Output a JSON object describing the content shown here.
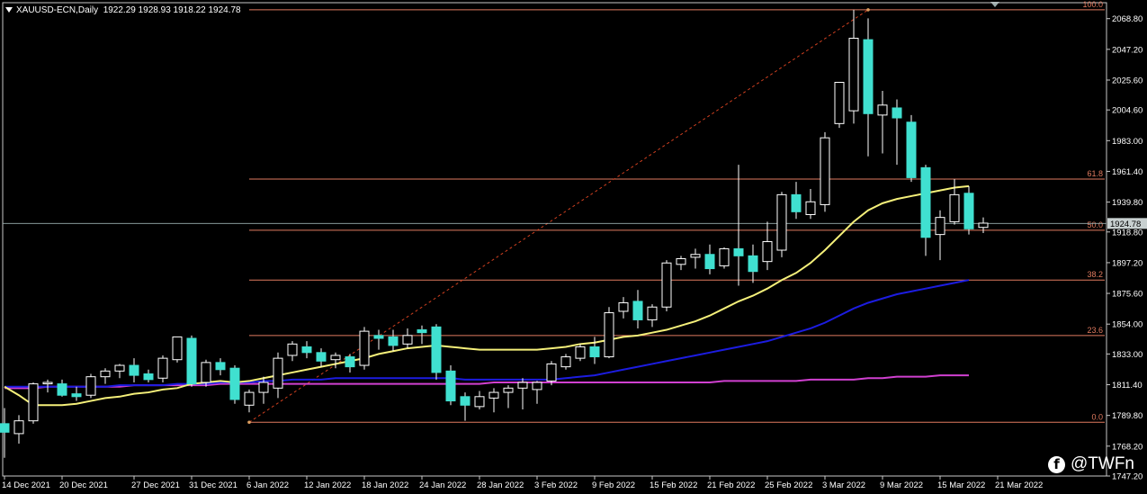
{
  "header": {
    "symbol": "XAUUSD-ECN,Daily",
    "ohlc": "1922.29 1928.93 1918.22 1924.78"
  },
  "watermark": {
    "icon": "facebook-icon",
    "handle": "@TWFn"
  },
  "chart_data": {
    "type": "candlestick",
    "ylim": [
      1747.2,
      2080.0
    ],
    "y_ticks": [
      2068.8,
      2047.2,
      2025.6,
      2004.6,
      1983.0,
      1961.4,
      1939.8,
      1918.8,
      1897.2,
      1875.6,
      1854.0,
      1833.0,
      1811.4,
      1789.8,
      1768.2,
      1747.2
    ],
    "y_tick_labels": [
      "2068.80",
      "2047.20",
      "2025.60",
      "2004.60",
      "1983.00",
      "1961.40",
      "1939.80",
      "1918.80",
      "1897.20",
      "1875.60",
      "1854.00",
      "1833.00",
      "1811.40",
      "1789.80",
      "1768.20",
      "1747.20"
    ],
    "x_tick_labels": [
      "14 Dec 2021",
      "20 Dec 2021",
      "27 Dec 2021",
      "31 Dec 2021",
      "6 Jan 2022",
      "12 Jan 2022",
      "18 Jan 2022",
      "24 Jan 2022",
      "28 Jan 2022",
      "3 Feb 2022",
      "9 Feb 2022",
      "15 Feb 2022",
      "21 Feb 2022",
      "25 Feb 2022",
      "3 Mar 2022",
      "9 Mar 2022",
      "15 Mar 2022",
      "21 Mar 2022"
    ],
    "x_tick_bar_index": [
      0,
      4,
      9,
      13,
      17,
      21,
      25,
      29,
      33,
      37,
      41,
      45,
      49,
      53,
      57,
      61,
      65,
      69
    ],
    "current_price": 1924.78,
    "current_price_label": "1924.78",
    "colors": {
      "bull": "#ffffff",
      "bear": "#40e0d0",
      "fib": "#e07a5f",
      "ma_fast": "#f5f07a",
      "ma_mid": "#1c1ce0",
      "ma_slow": "#d040d0",
      "current": "#9ab0b0"
    },
    "candles": [
      [
        1784,
        1795,
        1760,
        1778
      ],
      [
        1777,
        1790,
        1770,
        1786
      ],
      [
        1786,
        1813,
        1784,
        1812
      ],
      [
        1812,
        1815,
        1806,
        1813
      ],
      [
        1812,
        1815,
        1803,
        1804
      ],
      [
        1805,
        1810,
        1800,
        1803
      ],
      [
        1804,
        1819,
        1802,
        1817
      ],
      [
        1817,
        1823,
        1812,
        1821
      ],
      [
        1821,
        1826,
        1816,
        1825
      ],
      [
        1825,
        1830,
        1813,
        1818
      ],
      [
        1819,
        1822,
        1813,
        1815
      ],
      [
        1816,
        1832,
        1813,
        1830
      ],
      [
        1829,
        1845,
        1827,
        1845
      ],
      [
        1844,
        1846,
        1810,
        1812
      ],
      [
        1813,
        1829,
        1810,
        1827
      ],
      [
        1827,
        1830,
        1818,
        1822
      ],
      [
        1823,
        1825,
        1798,
        1801
      ],
      [
        1797,
        1808,
        1792,
        1806
      ],
      [
        1806,
        1817,
        1798,
        1813
      ],
      [
        1809,
        1834,
        1802,
        1830
      ],
      [
        1832,
        1842,
        1828,
        1840
      ],
      [
        1838,
        1842,
        1830,
        1834
      ],
      [
        1834,
        1837,
        1824,
        1828
      ],
      [
        1829,
        1834,
        1823,
        1832
      ],
      [
        1831,
        1833,
        1820,
        1824
      ],
      [
        1825,
        1852,
        1822,
        1849
      ],
      [
        1846,
        1850,
        1836,
        1844
      ],
      [
        1845,
        1850,
        1835,
        1839
      ],
      [
        1840,
        1851,
        1837,
        1846
      ],
      [
        1850,
        1853,
        1840,
        1848
      ],
      [
        1852,
        1854,
        1815,
        1820
      ],
      [
        1821,
        1825,
        1797,
        1800
      ],
      [
        1803,
        1806,
        1786,
        1797
      ],
      [
        1796,
        1807,
        1794,
        1803
      ],
      [
        1802,
        1809,
        1792,
        1806
      ],
      [
        1806,
        1811,
        1795,
        1809
      ],
      [
        1809,
        1816,
        1794,
        1813
      ],
      [
        1808,
        1814,
        1798,
        1813
      ],
      [
        1814,
        1828,
        1811,
        1826
      ],
      [
        1824,
        1833,
        1822,
        1831
      ],
      [
        1830,
        1840,
        1828,
        1838
      ],
      [
        1838,
        1845,
        1826,
        1831
      ],
      [
        1831,
        1866,
        1830,
        1862
      ],
      [
        1863,
        1873,
        1858,
        1869
      ],
      [
        1870,
        1878,
        1851,
        1857
      ],
      [
        1857,
        1868,
        1852,
        1866
      ],
      [
        1866,
        1899,
        1863,
        1897
      ],
      [
        1896,
        1902,
        1892,
        1900
      ],
      [
        1901,
        1907,
        1893,
        1903
      ],
      [
        1903,
        1910,
        1889,
        1893
      ],
      [
        1895,
        1908,
        1893,
        1907
      ],
      [
        1907,
        1966,
        1881,
        1902
      ],
      [
        1902,
        1910,
        1883,
        1891
      ],
      [
        1898,
        1926,
        1892,
        1912
      ],
      [
        1906,
        1947,
        1901,
        1945
      ],
      [
        1945,
        1954,
        1928,
        1933
      ],
      [
        1931,
        1949,
        1928,
        1940
      ],
      [
        1938,
        1989,
        1933,
        1985
      ],
      [
        1995,
        2020,
        1992,
        2024
      ],
      [
        2004,
        2075,
        1995,
        2055
      ],
      [
        2054,
        2069,
        1972,
        2002
      ],
      [
        2001,
        2018,
        1974,
        2008
      ],
      [
        2006,
        2012,
        1966,
        1999
      ],
      [
        1996,
        2001,
        1954,
        1957
      ],
      [
        1964,
        1966,
        1902,
        1915
      ],
      [
        1917,
        1934,
        1899,
        1929
      ],
      [
        1926,
        1956,
        1924,
        1945
      ],
      [
        1946,
        1951,
        1917,
        1921
      ],
      [
        1922,
        1929,
        1918,
        1925
      ]
    ],
    "series": [
      {
        "values_from": "ma_fast"
      },
      {
        "values_from": "ma_mid"
      },
      {
        "values_from": "ma_slow"
      }
    ],
    "ma_fast": [
      1810,
      1804,
      1797,
      1797,
      1797,
      1798,
      1800,
      1802,
      1803,
      1805,
      1806,
      1808,
      1809,
      1812,
      1813,
      1814,
      1813,
      1814,
      1816,
      1818,
      1820,
      1822,
      1824,
      1826,
      1828,
      1830,
      1833,
      1835,
      1837,
      1838,
      1839,
      1838,
      1837,
      1836,
      1836,
      1836,
      1836,
      1836,
      1837,
      1838,
      1840,
      1841,
      1843,
      1845,
      1846,
      1848,
      1850,
      1853,
      1856,
      1860,
      1865,
      1870,
      1874,
      1879,
      1885,
      1890,
      1897,
      1906,
      1916,
      1926,
      1934,
      1939,
      1942,
      1944,
      1946,
      1948,
      1950,
      1951
    ],
    "ma_mid": [
      1810,
      1810,
      1810,
      1810,
      1810,
      1810,
      1810,
      1810,
      1811,
      1811,
      1811,
      1811,
      1812,
      1812,
      1812,
      1813,
      1813,
      1813,
      1814,
      1814,
      1815,
      1815,
      1815,
      1816,
      1816,
      1816,
      1816,
      1816,
      1816,
      1816,
      1816,
      1816,
      1815,
      1815,
      1815,
      1815,
      1815,
      1815,
      1815,
      1816,
      1817,
      1818,
      1820,
      1822,
      1824,
      1826,
      1828,
      1830,
      1832,
      1834,
      1836,
      1838,
      1840,
      1842,
      1845,
      1848,
      1851,
      1855,
      1860,
      1865,
      1869,
      1872,
      1875,
      1877,
      1879,
      1881,
      1883,
      1885
    ],
    "ma_slow": [
      1809,
      1809,
      1809,
      1810,
      1810,
      1810,
      1810,
      1810,
      1810,
      1811,
      1811,
      1811,
      1811,
      1811,
      1811,
      1812,
      1812,
      1812,
      1812,
      1812,
      1812,
      1812,
      1812,
      1812,
      1812,
      1812,
      1812,
      1812,
      1812,
      1812,
      1812,
      1812,
      1812,
      1812,
      1813,
      1813,
      1813,
      1813,
      1813,
      1813,
      1813,
      1813,
      1813,
      1813,
      1813,
      1813,
      1813,
      1813,
      1813,
      1813,
      1814,
      1814,
      1814,
      1814,
      1814,
      1814,
      1815,
      1815,
      1815,
      1815,
      1816,
      1816,
      1817,
      1817,
      1817,
      1818,
      1818,
      1818
    ],
    "fib_levels": [
      {
        "label": "100.0",
        "price": 2075.0
      },
      {
        "label": "61.8",
        "price": 1956.0
      },
      {
        "label": "50.0",
        "price": 1920.0
      },
      {
        "label": "38.2",
        "price": 1885.0
      },
      {
        "label": "23.6",
        "price": 1846.0
      },
      {
        "label": "0.0",
        "price": 1785.0
      }
    ],
    "fib_trend": {
      "from_bar": 17,
      "from_price": 1785.0,
      "to_bar": 60,
      "to_price": 2075.0
    }
  }
}
